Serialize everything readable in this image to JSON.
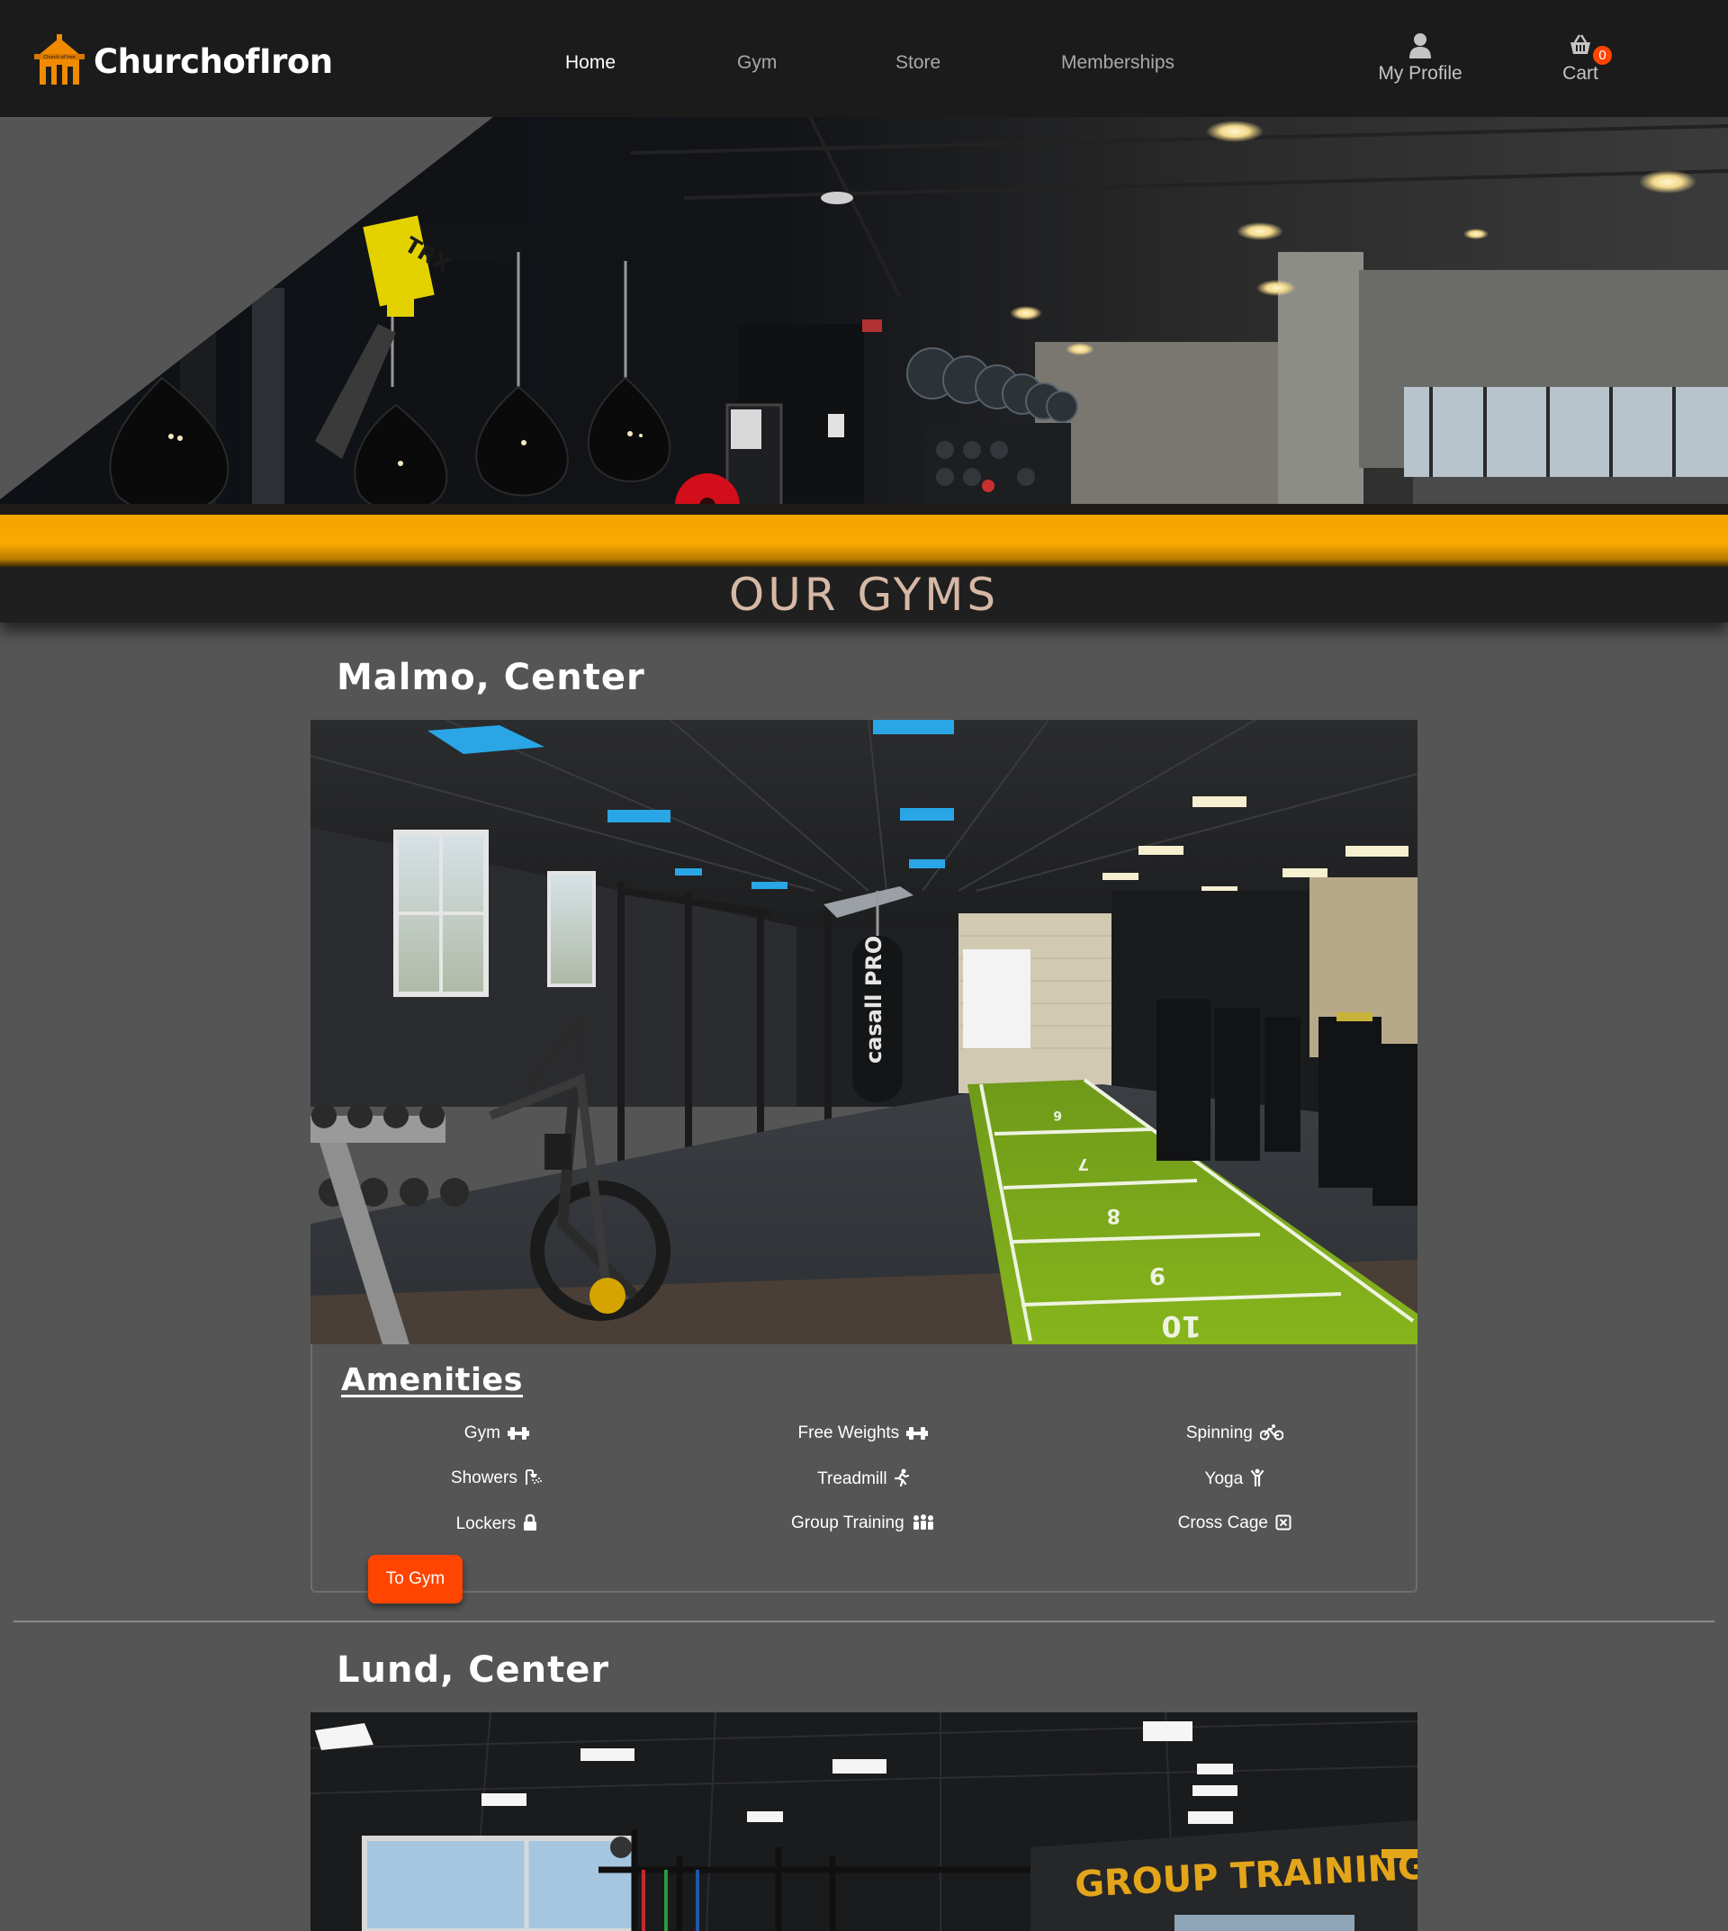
{
  "brand": {
    "name": "ChurchofIron",
    "logo_text": "Church of Iron"
  },
  "nav": {
    "links": [
      {
        "label": "Home",
        "active": true
      },
      {
        "label": "Gym",
        "active": false
      },
      {
        "label": "Store",
        "active": false
      },
      {
        "label": "Memberships",
        "active": false
      }
    ],
    "profile": {
      "label": "My Profile",
      "icon": "user-icon"
    },
    "cart": {
      "label": "Cart",
      "count": "0",
      "icon": "basket-icon"
    }
  },
  "hero": {
    "signs": {
      "trx": "TRX",
      "boxing_bag": "casall PRO",
      "wall_text": "GROUP TRAINING"
    }
  },
  "section": {
    "title": "OUR GYMS"
  },
  "gyms": [
    {
      "name": "Malmo, Center",
      "amenities_title": "Amenities",
      "amenities": [
        {
          "label": "Gym",
          "icon": "dumbbell-icon"
        },
        {
          "label": "Free Weights",
          "icon": "dumbbell-icon"
        },
        {
          "label": "Spinning",
          "icon": "bicycle-icon"
        },
        {
          "label": "Showers",
          "icon": "shower-icon"
        },
        {
          "label": "Treadmill",
          "icon": "running-icon"
        },
        {
          "label": "Yoga",
          "icon": "yoga-icon"
        },
        {
          "label": "Lockers",
          "icon": "lock-icon"
        },
        {
          "label": "Group Training",
          "icon": "users-icon"
        },
        {
          "label": "Cross Cage",
          "icon": "square-x-icon"
        }
      ],
      "button": "To Gym",
      "photo_marks": {
        "bag": "casall PRO",
        "track_numbers": [
          "6",
          "7",
          "8",
          "9",
          "10"
        ]
      }
    },
    {
      "name": "Lund, Center",
      "wall_sign": "GROUP TRAINING"
    }
  ],
  "colors": {
    "nav_bg": "#1b1b1b",
    "page_bg": "#555555",
    "accent_orange": "#f9a900",
    "button_orange": "#ff4500",
    "banner_text": "#d6b8a5"
  }
}
